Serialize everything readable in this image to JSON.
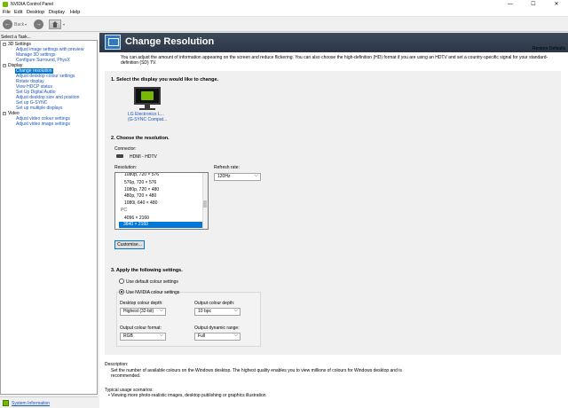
{
  "window": {
    "title": "NVIDIA Control Panel",
    "minimize": "—",
    "maximize": "☐",
    "close": "✕"
  },
  "menu": {
    "file": "File",
    "edit": "Edit",
    "desktop": "Desktop",
    "display": "Display",
    "help": "Help"
  },
  "toolbar": {
    "back_icon": "back-arrow-icon",
    "forward_icon": "forward-arrow-icon",
    "back_label": "Back",
    "caret": "▾"
  },
  "sidebar": {
    "title": "Select a Task...",
    "items": [
      {
        "label": "3D Settings",
        "level": 0,
        "expander": "−"
      },
      {
        "label": "Adjust image settings with preview",
        "level": 1
      },
      {
        "label": "Manage 3D settings",
        "level": 1
      },
      {
        "label": "Configure Surround, PhysX",
        "level": 1
      },
      {
        "label": "Display",
        "level": 0,
        "expander": "−"
      },
      {
        "label": "Change resolution",
        "level": 1,
        "selected": true
      },
      {
        "label": "Adjust desktop colour settings",
        "level": 1
      },
      {
        "label": "Rotate display",
        "level": 1
      },
      {
        "label": "View HDCP status",
        "level": 1
      },
      {
        "label": "Set Up Digital Audio",
        "level": 1
      },
      {
        "label": "Adjust desktop size and position",
        "level": 1
      },
      {
        "label": "Set up G-SYNC",
        "level": 1
      },
      {
        "label": "Set up multiple displays",
        "level": 1
      },
      {
        "label": "Video",
        "level": 0,
        "expander": "−"
      },
      {
        "label": "Adjust video colour settings",
        "level": 1
      },
      {
        "label": "Adjust video image settings",
        "level": 1
      }
    ],
    "system_info": "System Information"
  },
  "header": {
    "title": "Change Resolution",
    "restore": "Restore Defaults"
  },
  "description_top": "You can adjust the amount of information appearing on the screen and reduce flickering. You can also choose the high-definition (HD) format if you are using an HDTV and set a country-specific signal for your standard-definition (SD) TV.",
  "section1": {
    "heading": "1. Select the display you would like to change.",
    "display_line1": "LG Electronics L...",
    "display_line2": "(G-SYNC Compat..."
  },
  "section2": {
    "heading": "2. Choose the resolution.",
    "connector_label": "Connector:",
    "connector_value": "HDMI - HDTV",
    "resolution_label": "Resolution:",
    "resolutions": [
      "1080p, 720 × 576",
      "576p, 720 × 576",
      "1080p, 720 × 480",
      "480p, 720 × 480",
      "1080i, 640 × 480"
    ],
    "pc_group": "PC",
    "pc_resolutions": [
      "4096 × 2160",
      "3840 × 2160"
    ],
    "selected_resolution": "3840 × 2160",
    "refresh_label": "Refresh rate:",
    "refresh_value": "120Hz",
    "customise_button": "Customise..."
  },
  "section3": {
    "heading": "3. Apply the following settings.",
    "radio_default": "Use default colour settings",
    "radio_nvidia": "Use NVIDIA colour settings",
    "desktop_depth_label": "Desktop colour depth:",
    "desktop_depth_value": "Highest (32-bit)",
    "output_depth_label": "Output colour depth:",
    "output_depth_value": "10 bpc",
    "output_format_label": "Output colour format:",
    "output_format_value": "RGB",
    "dynamic_range_label": "Output dynamic range:",
    "dynamic_range_value": "Full"
  },
  "description": {
    "label": "Description:",
    "text_line1": "Set the number of available colours on the Windows desktop. The highest quality enables you to view millions of colours for Windows desktop and is",
    "text_line2": "recommended."
  },
  "usage": {
    "label": "Typical usage scenarios:",
    "item": "• Viewing more photo-realistic images, desktop publishing or graphics illustration"
  }
}
